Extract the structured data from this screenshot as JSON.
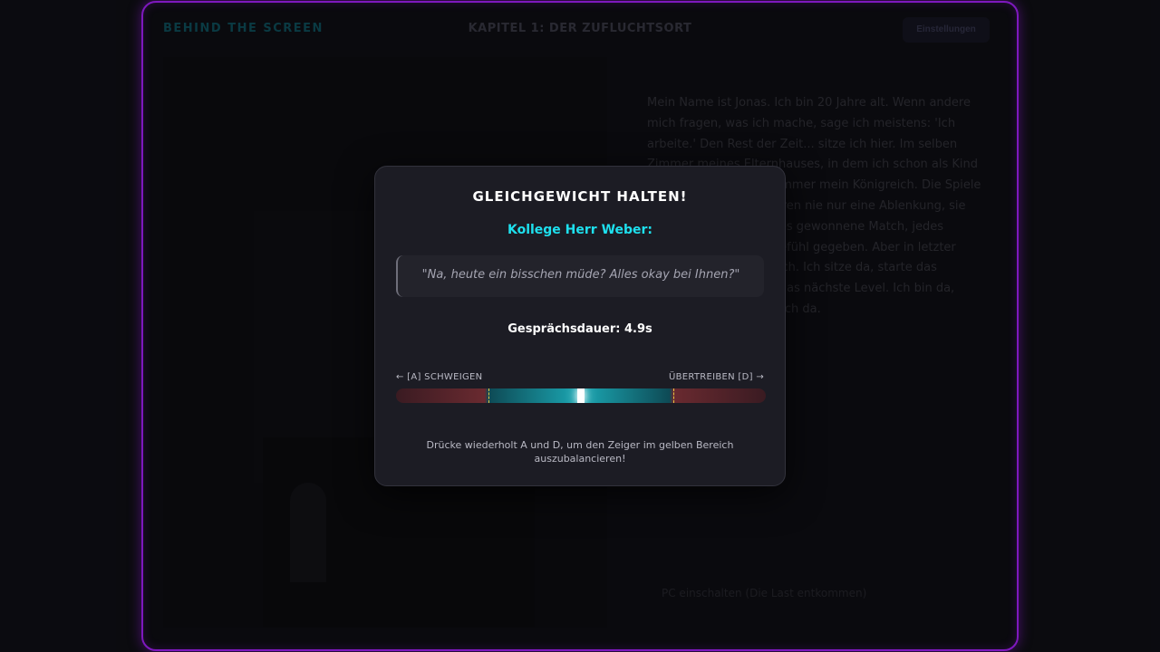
{
  "header": {
    "brand": "BEHIND THE SCREEN",
    "chapter": "KAPITEL 1: DER ZUFLUCHTSORT",
    "settings_label": "Einstellungen"
  },
  "story": {
    "text": "Mein Name ist Jonas. Ich bin 20 Jahre alt. Wenn andere mich fragen, was ich mache, sage ich meistens: 'Ich arbeite.' Den Rest der Zeit... sitze ich hier. Im selben Zimmer meines Elternhauses, in dem ich schon als Kind gespielt habe. Es war immer mein Königreich. Die Spiele auf dem Bildschirm waren nie nur eine Ablenkung, sie waren meine Welt. Jedes gewonnene Match, jedes Level-Up hat mir ein Gefühl gegeben. Aber in letzter Zeit... klicke ich nur noch. Ich sitze da, starte das nächste Match, starte das nächste Level. Ich bin da, aber ich bin nicht wirklich da.",
    "choice": "PC einschalten (Die Last entkommen)"
  },
  "modal": {
    "title": "GLEICHGEWICHT HALTEN!",
    "speaker": "Kollege Herr Weber:",
    "quote": "\"Na, heute ein bisschen müde? Alles okay bei Ihnen?\"",
    "timer": "Gesprächsdauer: 4.9s",
    "left_label": "← [A] SCHWEIGEN",
    "right_label": "ÜBERTREIBEN [D] →",
    "hint": "Drücke wiederholt A und D, um den Zeiger im gelben Bereich auszubalancieren!"
  },
  "balance": {
    "pointer_position": 0.5,
    "safe_zone": [
      0.25,
      0.75
    ]
  },
  "colors": {
    "frame_glow": "#9a1ee8",
    "speaker_accent": "#1ee0ee",
    "safe_zone": "#1ba8b4",
    "danger_zone": "#6a2a30",
    "zone_marker": "#e8c540"
  }
}
